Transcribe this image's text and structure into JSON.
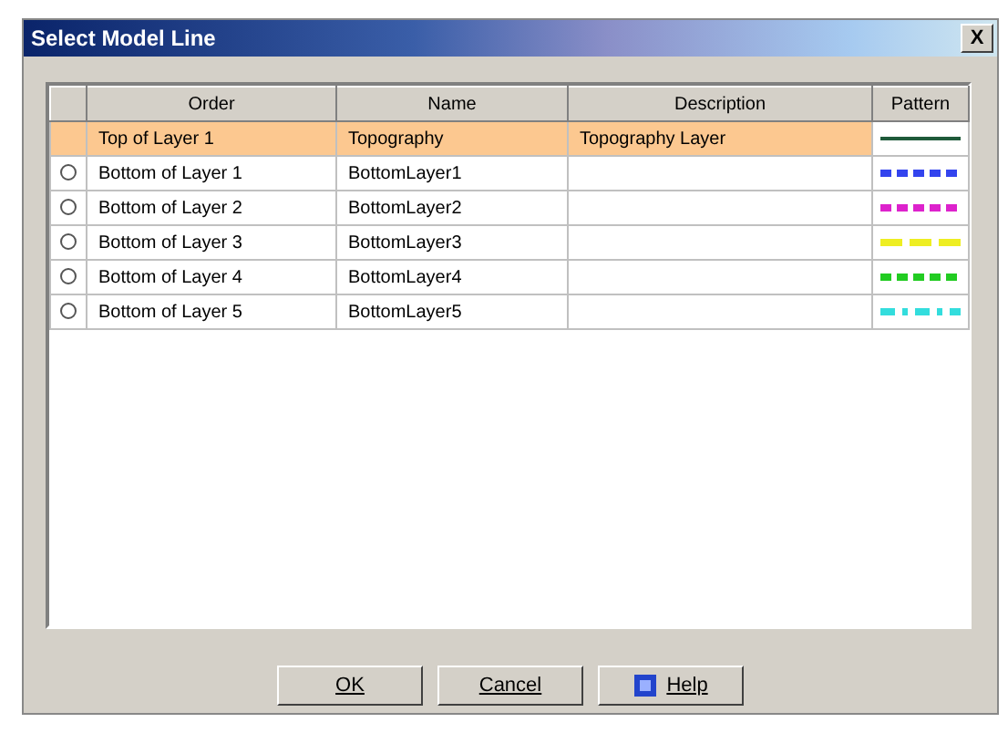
{
  "window": {
    "title": "Select Model Line",
    "close": "X"
  },
  "table": {
    "columns": [
      "Order",
      "Name",
      "Description",
      "Pattern"
    ],
    "rows": [
      {
        "order": "Top of Layer 1",
        "name": "Topography",
        "description": "Topography Layer",
        "selected": true,
        "pattern": {
          "kind": "solid",
          "color": "#1f5a3a"
        }
      },
      {
        "order": "Bottom of Layer 1",
        "name": "BottomLayer1",
        "selected": false,
        "pattern": {
          "kind": "dotted",
          "color": "#3344ee"
        }
      },
      {
        "order": "Bottom of Layer 2",
        "name": "BottomLayer2",
        "selected": false,
        "pattern": {
          "kind": "dotted",
          "color": "#dd22cc"
        }
      },
      {
        "order": "Bottom of Layer 3",
        "name": "BottomLayer3",
        "selected": false,
        "pattern": {
          "kind": "dashed",
          "color": "#eeee22"
        }
      },
      {
        "order": "Bottom of Layer 4",
        "name": "BottomLayer4",
        "selected": false,
        "pattern": {
          "kind": "dotted",
          "color": "#22cc22"
        }
      },
      {
        "order": "Bottom of Layer 5",
        "name": "BottomLayer5",
        "selected": false,
        "pattern": {
          "kind": "dashdot",
          "color": "#33dddd"
        }
      }
    ]
  },
  "buttons": [
    {
      "label": "OK",
      "kind": "plain"
    },
    {
      "label": "Cancel",
      "kind": "plain"
    },
    {
      "label": "Help",
      "kind": "help"
    }
  ]
}
